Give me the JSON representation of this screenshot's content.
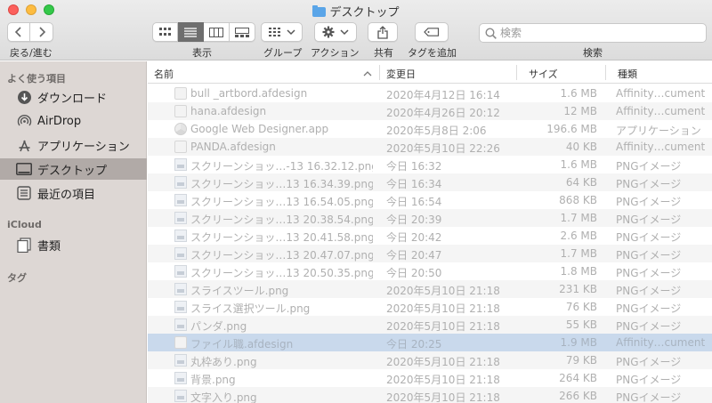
{
  "window": {
    "title": "デスクトップ"
  },
  "toolbar": {
    "nav_label": "戻る/進む",
    "view_label": "表示",
    "group_label": "グループ",
    "action_label": "アクション",
    "share_label": "共有",
    "tag_label": "タグを追加",
    "search_label": "検索",
    "search_placeholder": "検索"
  },
  "sidebar": {
    "favorites_title": "よく使う項目",
    "favorites": [
      {
        "label": "ダウンロード",
        "icon": "download-icon"
      },
      {
        "label": "AirDrop",
        "icon": "airdrop-icon"
      },
      {
        "label": "アプリケーション",
        "icon": "applications-icon"
      },
      {
        "label": "デスクトップ",
        "icon": "desktop-icon",
        "active": true
      },
      {
        "label": "最近の項目",
        "icon": "recents-icon"
      }
    ],
    "icloud_title": "iCloud",
    "icloud": [
      {
        "label": "書類",
        "icon": "documents-icon"
      }
    ],
    "tags_title": "タグ"
  },
  "columns": {
    "name": "名前",
    "date": "変更日",
    "size": "サイズ",
    "kind": "種類"
  },
  "files": [
    {
      "name": "bull _artbord.afdesign",
      "date": "2020年4月12日 16:14",
      "size": "1.6 MB",
      "kind": "Affinity…cument",
      "icon": "document-icon"
    },
    {
      "name": "hana.afdesign",
      "date": "2020年4月26日 20:12",
      "size": "12 MB",
      "kind": "Affinity…cument",
      "icon": "document-icon"
    },
    {
      "name": "Google Web Designer.app",
      "date": "2020年5月8日 2:06",
      "size": "196.6 MB",
      "kind": "アプリケーション",
      "icon": "app-icon"
    },
    {
      "name": "PANDA.afdesign",
      "date": "2020年5月10日 22:26",
      "size": "40 KB",
      "kind": "Affinity…cument",
      "icon": "document-icon"
    },
    {
      "name": "スクリーンショッ…-13 16.32.12.png",
      "date": "今日 16:32",
      "size": "1.6 MB",
      "kind": "PNGイメージ",
      "icon": "image-icon"
    },
    {
      "name": "スクリーンショッ…13 16.34.39.png",
      "date": "今日 16:34",
      "size": "64 KB",
      "kind": "PNGイメージ",
      "icon": "image-icon"
    },
    {
      "name": "スクリーンショッ…13 16.54.05.png",
      "date": "今日 16:54",
      "size": "868 KB",
      "kind": "PNGイメージ",
      "icon": "image-icon"
    },
    {
      "name": "スクリーンショッ…13 20.38.54.png",
      "date": "今日 20:39",
      "size": "1.7 MB",
      "kind": "PNGイメージ",
      "icon": "image-icon"
    },
    {
      "name": "スクリーンショッ…13 20.41.58.png",
      "date": "今日 20:42",
      "size": "2.6 MB",
      "kind": "PNGイメージ",
      "icon": "image-icon"
    },
    {
      "name": "スクリーンショッ…13 20.47.07.png",
      "date": "今日 20:47",
      "size": "1.7 MB",
      "kind": "PNGイメージ",
      "icon": "image-icon"
    },
    {
      "name": "スクリーンショッ…13 20.50.35.png",
      "date": "今日 20:50",
      "size": "1.8 MB",
      "kind": "PNGイメージ",
      "icon": "image-icon"
    },
    {
      "name": "スライスツール.png",
      "date": "2020年5月10日 21:18",
      "size": "231 KB",
      "kind": "PNGイメージ",
      "icon": "image-icon"
    },
    {
      "name": "スライス選択ツール.png",
      "date": "2020年5月10日 21:18",
      "size": "76 KB",
      "kind": "PNGイメージ",
      "icon": "image-icon"
    },
    {
      "name": "パンダ.png",
      "date": "2020年5月10日 21:18",
      "size": "55 KB",
      "kind": "PNGイメージ",
      "icon": "image-icon"
    },
    {
      "name": "ファイル職.afdesign",
      "date": "今日 20:25",
      "size": "1.9 MB",
      "kind": "Affinity…cument",
      "icon": "document-icon",
      "selected": true
    },
    {
      "name": "丸枠あり.png",
      "date": "2020年5月10日 21:18",
      "size": "79 KB",
      "kind": "PNGイメージ",
      "icon": "image-icon"
    },
    {
      "name": "背景.png",
      "date": "2020年5月10日 21:18",
      "size": "264 KB",
      "kind": "PNGイメージ",
      "icon": "image-icon"
    },
    {
      "name": "文字入り.png",
      "date": "2020年5月10日 21:18",
      "size": "266 KB",
      "kind": "PNGイメージ",
      "icon": "image-icon"
    }
  ]
}
